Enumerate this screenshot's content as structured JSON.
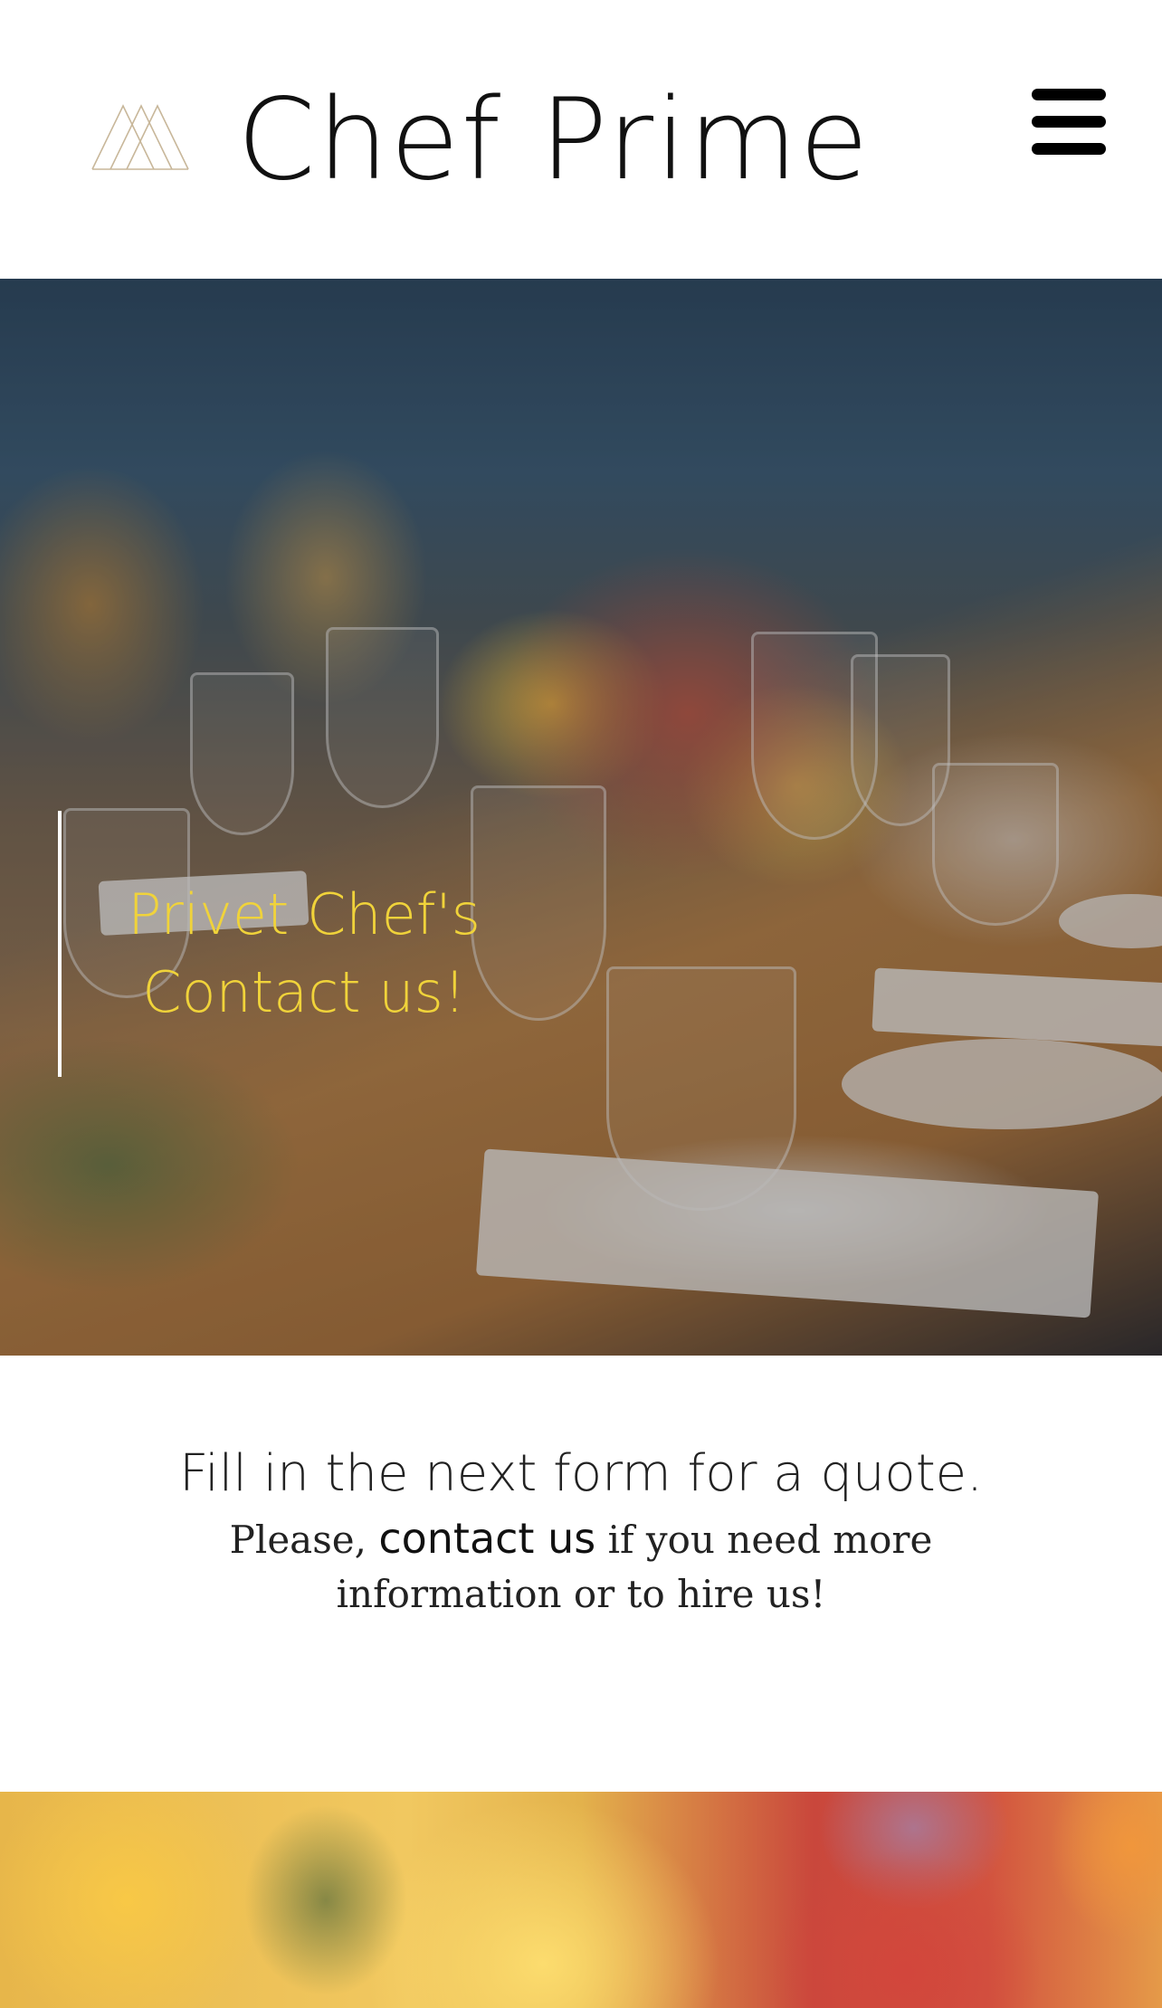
{
  "header": {
    "brand": "Chef Prime",
    "logo_icon": "triangle-mountains-icon",
    "menu_icon": "hamburger-menu-icon"
  },
  "hero": {
    "title_line1": "Privet Chef's",
    "title_line2": "Contact us!",
    "accent_color": "#f0d33a"
  },
  "info": {
    "heading": "Fill in the next form for a quote.",
    "text_before": "Please, ",
    "link_label": "contact us",
    "text_after": " if you need more information or to hire us!"
  }
}
